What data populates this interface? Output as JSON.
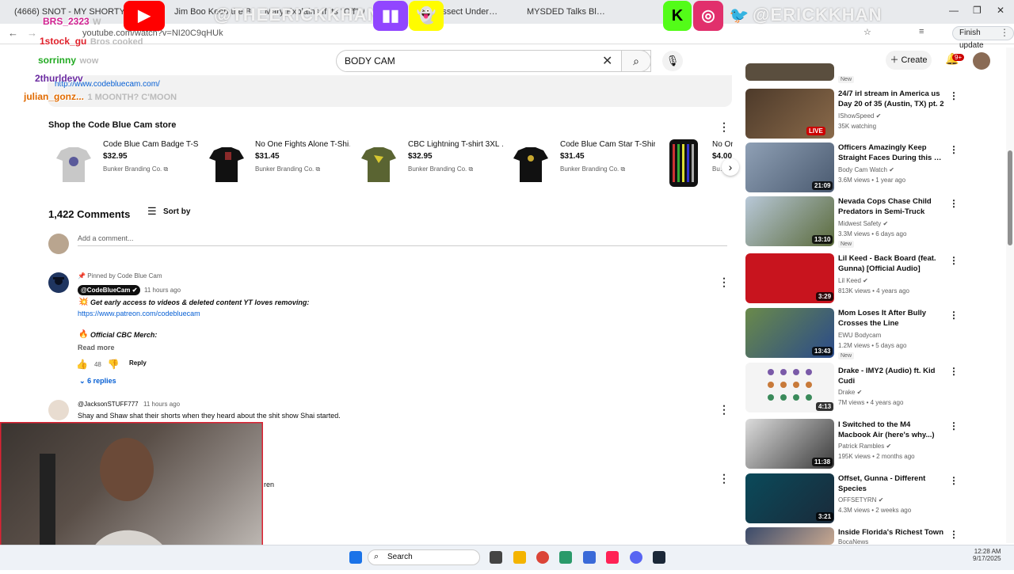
{
  "browser": {
    "tabs": [
      {
        "label": "(4666) SNOT - MY SHORTY TH…"
      },
      {
        "label": "Jim Boo Keep the Bla…"
      },
      {
        "label": "Mary Explains If Its \"Off\" Wh…"
      },
      {
        "label": "Dissect Under…"
      },
      {
        "label": "MYSDED Talks Bl…"
      }
    ],
    "url": "youtube.com/watch?v=NI20C9qHUk",
    "finish_update": "Finish update"
  },
  "header": {
    "search_value": "BODY CAM",
    "create_label": "Create",
    "notif_count": "9+"
  },
  "description": {
    "link": "http://www.codebluecam.com/"
  },
  "shop": {
    "title": "Shop the Code Blue Cam store",
    "products": [
      {
        "title": "Code Blue Cam Badge T-S…",
        "price": "$32.95",
        "vendor": "Bunker Branding Co."
      },
      {
        "title": "No One Fights Alone T-Shi…",
        "price": "$31.45",
        "vendor": "Bunker Branding Co."
      },
      {
        "title": "CBC Lightning T-shirt 3XL …",
        "price": "$32.95",
        "vendor": "Bunker Branding Co."
      },
      {
        "title": "Code Blue Cam Star T-Shir…",
        "price": "$31.45",
        "vendor": "Bunker Branding Co."
      },
      {
        "title": "No On…",
        "price": "$4.00",
        "vendor": "Bu…"
      }
    ]
  },
  "comments": {
    "count_label": "1,422 Comments",
    "sort_label": "Sort by",
    "add_placeholder": "Add a comment...",
    "pinned": {
      "pinned_label": "Pinned by Code Blue Cam",
      "author": "@CodeBlueCam",
      "time": "11 hours ago",
      "line1": "Get early access to videos & deleted content YT loves removing:",
      "link": "https://www.patreon.com/codebluecam",
      "line2": "Official CBC Merch:",
      "read_more": "Read more",
      "likes": "48",
      "reply": "Reply",
      "replies": "6 replies"
    },
    "second": {
      "author": "@JacksonSTUFF777",
      "time": "11 hours ago",
      "text": "Shay and Shaw shat their shorts when they heard about the shit show Shai started."
    },
    "third_fragment": "ren"
  },
  "sidebar": {
    "videos": [
      {
        "title": "",
        "channel": "",
        "meta": "",
        "duration": "",
        "new": "New"
      },
      {
        "title": "24/7 irl stream in America us Day 20 of 35 (Austin, TX) pt. 2",
        "channel": "IShowSpeed",
        "meta": "35K watching",
        "duration": "LIVE",
        "new": ""
      },
      {
        "title": "Officers Amazingly Keep Straight Faces During this …",
        "channel": "Body Cam Watch",
        "meta": "3.6M views • 1 year ago",
        "duration": "21:09",
        "new": ""
      },
      {
        "title": "Nevada Cops Chase Child Predators in Semi-Truck",
        "channel": "Midwest Safety",
        "meta": "3.3M views • 6 days ago",
        "duration": "13:10",
        "new": "New"
      },
      {
        "title": "Lil Keed - Back Board (feat. Gunna) [Official Audio]",
        "channel": "Lil Keed",
        "meta": "813K views • 4 years ago",
        "duration": "3:29",
        "new": ""
      },
      {
        "title": "Mom Loses It After Bully Crosses the Line",
        "channel": "EWU Bodycam",
        "meta": "1.2M views • 5 days ago",
        "duration": "13:43",
        "new": "New"
      },
      {
        "title": "Drake - IMY2 (Audio) ft. Kid Cudi",
        "channel": "Drake",
        "meta": "7M views • 4 years ago",
        "duration": "4:13",
        "new": ""
      },
      {
        "title": "I Switched to the M4 Macbook Air (here's why...)",
        "channel": "Patrick Rambles",
        "meta": "195K views • 2 months ago",
        "duration": "11:38",
        "new": ""
      },
      {
        "title": "Offset, Gunna - Different Species",
        "channel": "OFFSETYRN",
        "meta": "4.3M views • 2 weeks ago",
        "duration": "3:21",
        "new": ""
      },
      {
        "title": "Inside Florida's Richest Town",
        "channel": "BocaNews",
        "meta": "",
        "duration": "",
        "new": ""
      }
    ]
  },
  "taskbar": {
    "search": "Search",
    "time": "12:28 AM",
    "date": "9/17/2025"
  },
  "overlay": {
    "handle": "@ERICKKHAN",
    "handle_mid": "@THEERICKKHAN",
    "chat": [
      {
        "name": "BRS_2323",
        "msg": "W",
        "color": "#d02090"
      },
      {
        "name": "1stock_gu",
        "msg": "Bros cooked",
        "color": "#e0202a"
      },
      {
        "name": "sorrinny",
        "msg": "wow",
        "color": "#22aa22"
      },
      {
        "name": "2thurldevv",
        "msg": "",
        "color": "#6a2aa0"
      },
      {
        "name": "julian_gonz...",
        "msg": "1 MOONTH? C'MOON",
        "color": "#e06a00"
      }
    ]
  },
  "colors": {
    "brand_red": "#ff0000",
    "link_blue": "#065fd4",
    "twitch": "#9146ff",
    "snap": "#fffc00",
    "kick": "#53fc18",
    "twitter": "#1da1f2"
  }
}
